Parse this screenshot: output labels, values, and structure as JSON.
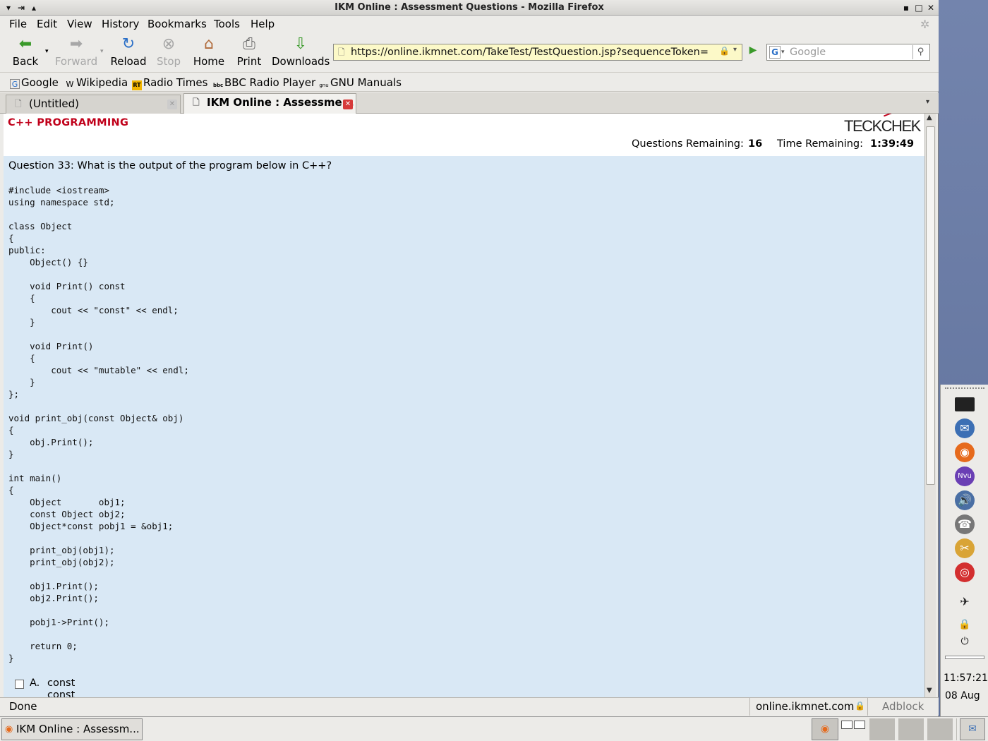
{
  "window": {
    "title": "IKM Online : Assessment Questions - Mozilla Firefox"
  },
  "menu": [
    "File",
    "Edit",
    "View",
    "History",
    "Bookmarks",
    "Tools",
    "Help"
  ],
  "nav": {
    "back": "Back",
    "forward": "Forward",
    "reload": "Reload",
    "stop": "Stop",
    "home": "Home",
    "print": "Print",
    "downloads": "Downloads"
  },
  "url": "https://online.ikmnet.com/TakeTest/TestQuestion.jsp?sequenceToken=",
  "search_placeholder": "Google",
  "bookmarks": [
    "Google",
    "Wikipedia",
    "Radio Times",
    "BBC Radio Player",
    "GNU Manuals"
  ],
  "bookmark_icons": [
    "G",
    "W",
    "RT",
    "bbc",
    "gnu"
  ],
  "tabs": [
    {
      "label": "(Untitled)"
    },
    {
      "label": "IKM Online : Assessme..."
    }
  ],
  "page": {
    "subject": "C++ PROGRAMMING",
    "logo": "TECKCHEK",
    "questions_remaining_label": "Questions Remaining:",
    "questions_remaining": "16",
    "time_remaining_label": "Time Remaining:",
    "time_remaining": "1:39:49",
    "question": "Question 33: What is the output of the program below in C++?",
    "code": "#include <iostream>\nusing namespace std;\n\nclass Object\n{\npublic:\n    Object() {}\n\n    void Print() const\n    {\n        cout << \"const\" << endl;\n    }\n\n    void Print()\n    {\n        cout << \"mutable\" << endl;\n    }\n};\n\nvoid print_obj(const Object& obj)\n{\n    obj.Print();\n}\n\nint main()\n{\n    Object       obj1;\n    const Object obj2;\n    Object*const pobj1 = &obj1;\n\n    print_obj(obj1);\n    print_obj(obj2);\n\n    obj1.Print();\n    obj2.Print();\n\n    pobj1->Print();\n\n    return 0;\n}",
    "answer_a_letter": "A.",
    "answer_a_line1": "const",
    "answer_a_line2": "const"
  },
  "status": {
    "text": "Done",
    "host": "online.ikmnet.com",
    "adblock": "Adblock"
  },
  "clock": {
    "time": "11:57:21",
    "date": "08 Aug"
  },
  "taskbar": {
    "task": "IKM Online : Assessm..."
  },
  "colors": {
    "subject": "#c0001a",
    "question_bg": "#d9e8f5",
    "url_bg": "#fcf9c8"
  }
}
